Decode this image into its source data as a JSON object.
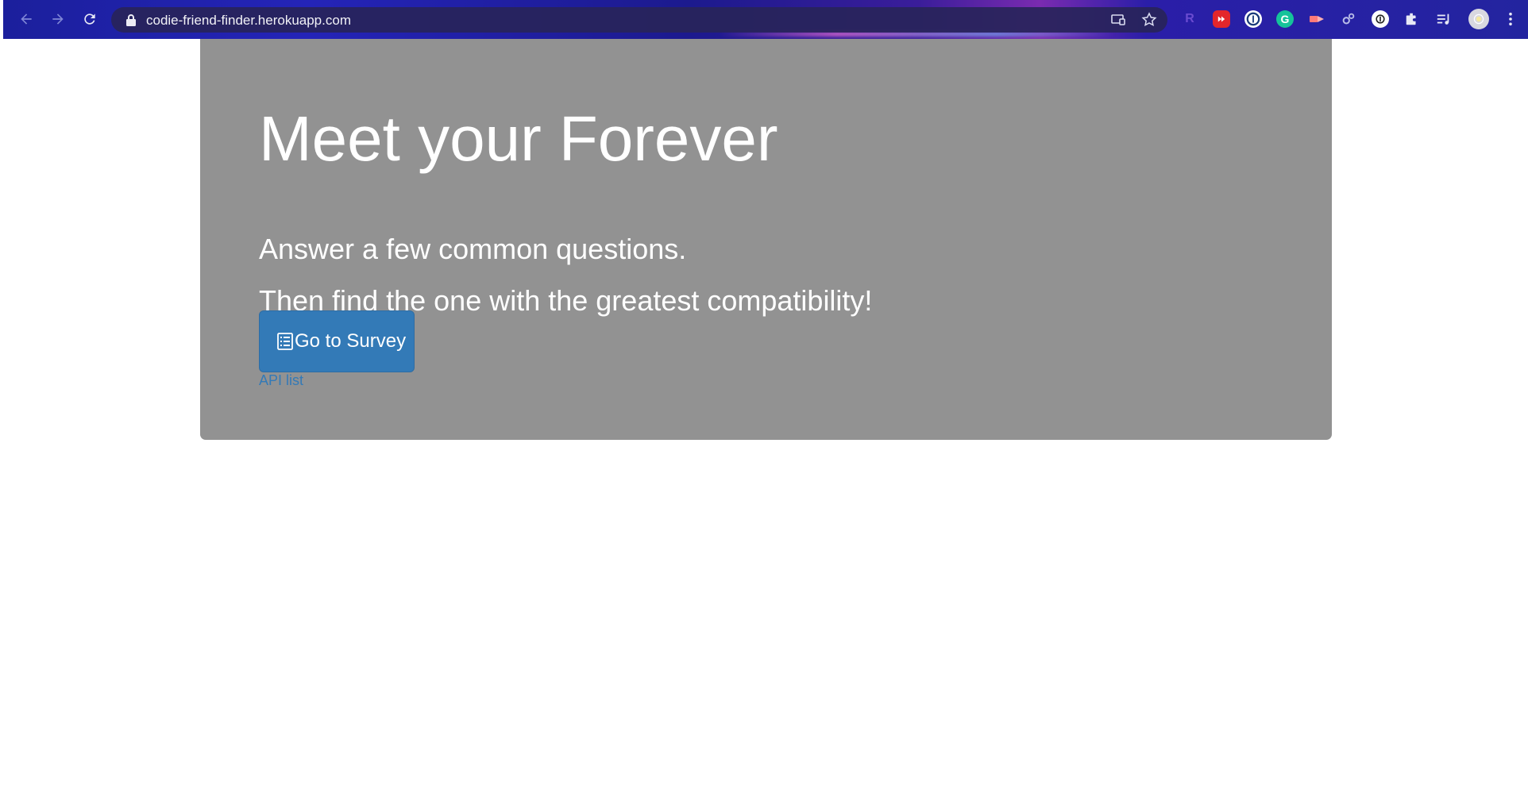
{
  "browser": {
    "url": "codie-friend-finder.herokuapp.com",
    "nav_icons": [
      "back-arrow-icon",
      "forward-arrow-icon",
      "reload-icon"
    ],
    "toolbar_icons": [
      "cast-icon",
      "bookmark-star-icon",
      "extension-r-icon",
      "extension-youtube-icon",
      "extension-onepassword-icon",
      "extension-grammarly-icon",
      "extension-video-icon",
      "extension-gear-icon",
      "extension-circle-icon",
      "extensions-puzzle-icon",
      "media-queue-icon",
      "profile-avatar",
      "menu-kebab-icon"
    ]
  },
  "hero": {
    "title": "Meet your Forever",
    "line1": "Answer a few common questions.",
    "line2": "Then find the one with the greatest compatibility!",
    "survey_button_label": "Go to Survey",
    "survey_button_icon": "list-alt-icon",
    "api_link_label": "API list"
  },
  "colors": {
    "jumbotron_bg": "#929292",
    "button_primary": "#337ab7",
    "link": "#337ab7"
  }
}
